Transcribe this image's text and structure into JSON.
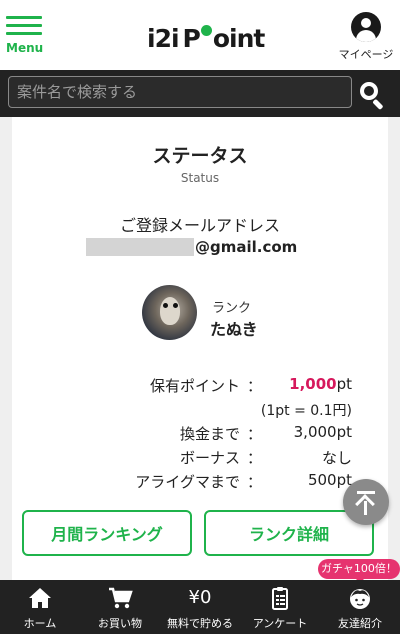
{
  "header": {
    "menu_label": "Menu",
    "logo_left": "i2i",
    "logo_right": "oint",
    "logo_p": "P",
    "mypage_label": "マイページ"
  },
  "search": {
    "placeholder": "案件名で検索する"
  },
  "status": {
    "title": "ステータス",
    "subtitle": "Status",
    "email_label": "ご登録メールアドレス",
    "email_domain": "@gmail.com",
    "rank_label": "ランク",
    "rank_name": "たぬき"
  },
  "points": {
    "held_label": "保有ポイント",
    "held_value": "1,000",
    "held_unit": "pt",
    "rate_note": "(1pt = 0.1円)",
    "cashout_label": "換金まで",
    "cashout_value": "3,000pt",
    "bonus_label": "ボーナス",
    "bonus_value": "なし",
    "next_rank_label": "アライグマまで",
    "next_rank_value": "500pt",
    "colon": "："
  },
  "buttons": {
    "monthly_ranking": "月間ランキング",
    "rank_detail": "ランク詳細"
  },
  "bottom_nav": {
    "badge": "ガチャ100倍！",
    "items": [
      {
        "label": "ホーム",
        "icon": "home-icon"
      },
      {
        "label": "お買い物",
        "icon": "cart-icon"
      },
      {
        "label": "無料で貯める",
        "icon": "yen-icon",
        "icon_text": "¥0"
      },
      {
        "label": "アンケート",
        "icon": "clipboard-icon"
      },
      {
        "label": "友達紹介",
        "icon": "friend-face-icon"
      }
    ]
  },
  "colors": {
    "brand_green": "#1fb34b",
    "highlight_pink": "#d6185c",
    "nav_dark": "#222222"
  }
}
